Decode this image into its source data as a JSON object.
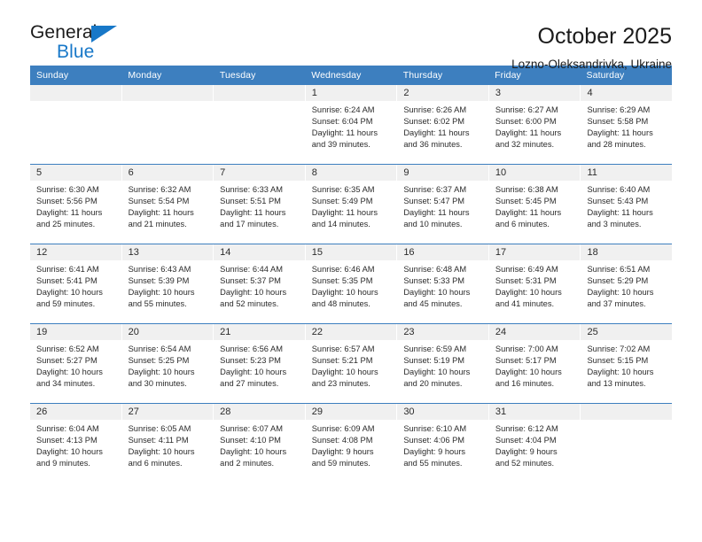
{
  "logo": {
    "word_one": "General",
    "word_two": "Blue",
    "triangle_color": "#1878c8",
    "icon": "triangle-logo-icon"
  },
  "header": {
    "title": "October 2025",
    "subtitle": "Lozno-Oleksandrivka, Ukraine"
  },
  "colors": {
    "header_blue": "#3d7fbf",
    "date_band_gray": "#f0f0f0",
    "text": "#2b2b2b",
    "logo_blue": "#1878c8"
  },
  "calendar": {
    "day_headers": [
      "Sunday",
      "Monday",
      "Tuesday",
      "Wednesday",
      "Thursday",
      "Friday",
      "Saturday"
    ],
    "weeks": [
      [
        {
          "date": "",
          "empty": true
        },
        {
          "date": "",
          "empty": true
        },
        {
          "date": "",
          "empty": true
        },
        {
          "date": "1",
          "sunrise": "Sunrise: 6:24 AM",
          "sunset": "Sunset: 6:04 PM",
          "daylight_line1": "Daylight: 11 hours",
          "daylight_line2": "and 39 minutes."
        },
        {
          "date": "2",
          "sunrise": "Sunrise: 6:26 AM",
          "sunset": "Sunset: 6:02 PM",
          "daylight_line1": "Daylight: 11 hours",
          "daylight_line2": "and 36 minutes."
        },
        {
          "date": "3",
          "sunrise": "Sunrise: 6:27 AM",
          "sunset": "Sunset: 6:00 PM",
          "daylight_line1": "Daylight: 11 hours",
          "daylight_line2": "and 32 minutes."
        },
        {
          "date": "4",
          "sunrise": "Sunrise: 6:29 AM",
          "sunset": "Sunset: 5:58 PM",
          "daylight_line1": "Daylight: 11 hours",
          "daylight_line2": "and 28 minutes."
        }
      ],
      [
        {
          "date": "5",
          "sunrise": "Sunrise: 6:30 AM",
          "sunset": "Sunset: 5:56 PM",
          "daylight_line1": "Daylight: 11 hours",
          "daylight_line2": "and 25 minutes."
        },
        {
          "date": "6",
          "sunrise": "Sunrise: 6:32 AM",
          "sunset": "Sunset: 5:54 PM",
          "daylight_line1": "Daylight: 11 hours",
          "daylight_line2": "and 21 minutes."
        },
        {
          "date": "7",
          "sunrise": "Sunrise: 6:33 AM",
          "sunset": "Sunset: 5:51 PM",
          "daylight_line1": "Daylight: 11 hours",
          "daylight_line2": "and 17 minutes."
        },
        {
          "date": "8",
          "sunrise": "Sunrise: 6:35 AM",
          "sunset": "Sunset: 5:49 PM",
          "daylight_line1": "Daylight: 11 hours",
          "daylight_line2": "and 14 minutes."
        },
        {
          "date": "9",
          "sunrise": "Sunrise: 6:37 AM",
          "sunset": "Sunset: 5:47 PM",
          "daylight_line1": "Daylight: 11 hours",
          "daylight_line2": "and 10 minutes."
        },
        {
          "date": "10",
          "sunrise": "Sunrise: 6:38 AM",
          "sunset": "Sunset: 5:45 PM",
          "daylight_line1": "Daylight: 11 hours",
          "daylight_line2": "and 6 minutes."
        },
        {
          "date": "11",
          "sunrise": "Sunrise: 6:40 AM",
          "sunset": "Sunset: 5:43 PM",
          "daylight_line1": "Daylight: 11 hours",
          "daylight_line2": "and 3 minutes."
        }
      ],
      [
        {
          "date": "12",
          "sunrise": "Sunrise: 6:41 AM",
          "sunset": "Sunset: 5:41 PM",
          "daylight_line1": "Daylight: 10 hours",
          "daylight_line2": "and 59 minutes."
        },
        {
          "date": "13",
          "sunrise": "Sunrise: 6:43 AM",
          "sunset": "Sunset: 5:39 PM",
          "daylight_line1": "Daylight: 10 hours",
          "daylight_line2": "and 55 minutes."
        },
        {
          "date": "14",
          "sunrise": "Sunrise: 6:44 AM",
          "sunset": "Sunset: 5:37 PM",
          "daylight_line1": "Daylight: 10 hours",
          "daylight_line2": "and 52 minutes."
        },
        {
          "date": "15",
          "sunrise": "Sunrise: 6:46 AM",
          "sunset": "Sunset: 5:35 PM",
          "daylight_line1": "Daylight: 10 hours",
          "daylight_line2": "and 48 minutes."
        },
        {
          "date": "16",
          "sunrise": "Sunrise: 6:48 AM",
          "sunset": "Sunset: 5:33 PM",
          "daylight_line1": "Daylight: 10 hours",
          "daylight_line2": "and 45 minutes."
        },
        {
          "date": "17",
          "sunrise": "Sunrise: 6:49 AM",
          "sunset": "Sunset: 5:31 PM",
          "daylight_line1": "Daylight: 10 hours",
          "daylight_line2": "and 41 minutes."
        },
        {
          "date": "18",
          "sunrise": "Sunrise: 6:51 AM",
          "sunset": "Sunset: 5:29 PM",
          "daylight_line1": "Daylight: 10 hours",
          "daylight_line2": "and 37 minutes."
        }
      ],
      [
        {
          "date": "19",
          "sunrise": "Sunrise: 6:52 AM",
          "sunset": "Sunset: 5:27 PM",
          "daylight_line1": "Daylight: 10 hours",
          "daylight_line2": "and 34 minutes."
        },
        {
          "date": "20",
          "sunrise": "Sunrise: 6:54 AM",
          "sunset": "Sunset: 5:25 PM",
          "daylight_line1": "Daylight: 10 hours",
          "daylight_line2": "and 30 minutes."
        },
        {
          "date": "21",
          "sunrise": "Sunrise: 6:56 AM",
          "sunset": "Sunset: 5:23 PM",
          "daylight_line1": "Daylight: 10 hours",
          "daylight_line2": "and 27 minutes."
        },
        {
          "date": "22",
          "sunrise": "Sunrise: 6:57 AM",
          "sunset": "Sunset: 5:21 PM",
          "daylight_line1": "Daylight: 10 hours",
          "daylight_line2": "and 23 minutes."
        },
        {
          "date": "23",
          "sunrise": "Sunrise: 6:59 AM",
          "sunset": "Sunset: 5:19 PM",
          "daylight_line1": "Daylight: 10 hours",
          "daylight_line2": "and 20 minutes."
        },
        {
          "date": "24",
          "sunrise": "Sunrise: 7:00 AM",
          "sunset": "Sunset: 5:17 PM",
          "daylight_line1": "Daylight: 10 hours",
          "daylight_line2": "and 16 minutes."
        },
        {
          "date": "25",
          "sunrise": "Sunrise: 7:02 AM",
          "sunset": "Sunset: 5:15 PM",
          "daylight_line1": "Daylight: 10 hours",
          "daylight_line2": "and 13 minutes."
        }
      ],
      [
        {
          "date": "26",
          "sunrise": "Sunrise: 6:04 AM",
          "sunset": "Sunset: 4:13 PM",
          "daylight_line1": "Daylight: 10 hours",
          "daylight_line2": "and 9 minutes."
        },
        {
          "date": "27",
          "sunrise": "Sunrise: 6:05 AM",
          "sunset": "Sunset: 4:11 PM",
          "daylight_line1": "Daylight: 10 hours",
          "daylight_line2": "and 6 minutes."
        },
        {
          "date": "28",
          "sunrise": "Sunrise: 6:07 AM",
          "sunset": "Sunset: 4:10 PM",
          "daylight_line1": "Daylight: 10 hours",
          "daylight_line2": "and 2 minutes."
        },
        {
          "date": "29",
          "sunrise": "Sunrise: 6:09 AM",
          "sunset": "Sunset: 4:08 PM",
          "daylight_line1": "Daylight: 9 hours",
          "daylight_line2": "and 59 minutes."
        },
        {
          "date": "30",
          "sunrise": "Sunrise: 6:10 AM",
          "sunset": "Sunset: 4:06 PM",
          "daylight_line1": "Daylight: 9 hours",
          "daylight_line2": "and 55 minutes."
        },
        {
          "date": "31",
          "sunrise": "Sunrise: 6:12 AM",
          "sunset": "Sunset: 4:04 PM",
          "daylight_line1": "Daylight: 9 hours",
          "daylight_line2": "and 52 minutes."
        },
        {
          "date": "",
          "empty": true
        }
      ]
    ]
  }
}
